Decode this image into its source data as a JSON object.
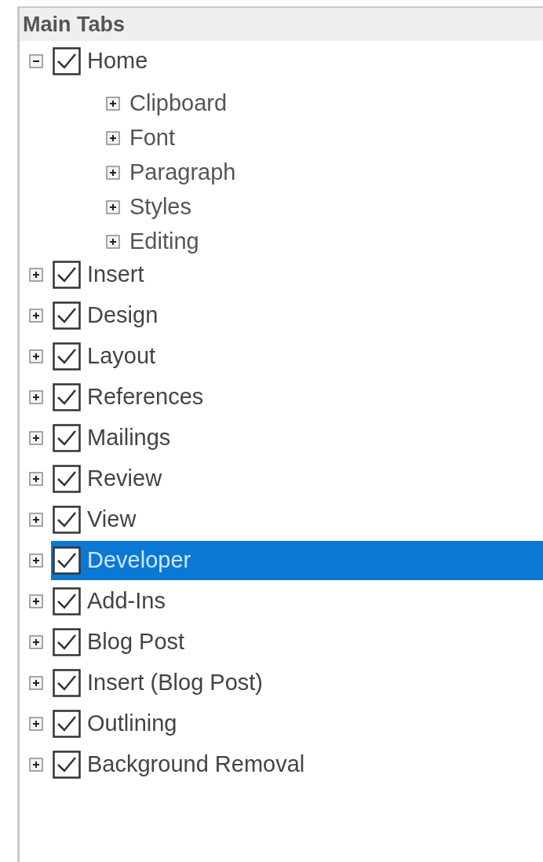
{
  "header": "Main Tabs",
  "tabs": [
    {
      "label": "Home",
      "checked": true,
      "expanded": true,
      "selected": false,
      "children": [
        {
          "label": "Clipboard",
          "expanded": false
        },
        {
          "label": "Font",
          "expanded": false
        },
        {
          "label": "Paragraph",
          "expanded": false
        },
        {
          "label": "Styles",
          "expanded": false
        },
        {
          "label": "Editing",
          "expanded": false
        }
      ]
    },
    {
      "label": "Insert",
      "checked": true,
      "expanded": false,
      "selected": false
    },
    {
      "label": "Design",
      "checked": true,
      "expanded": false,
      "selected": false
    },
    {
      "label": "Layout",
      "checked": true,
      "expanded": false,
      "selected": false
    },
    {
      "label": "References",
      "checked": true,
      "expanded": false,
      "selected": false
    },
    {
      "label": "Mailings",
      "checked": true,
      "expanded": false,
      "selected": false
    },
    {
      "label": "Review",
      "checked": true,
      "expanded": false,
      "selected": false
    },
    {
      "label": "View",
      "checked": true,
      "expanded": false,
      "selected": false
    },
    {
      "label": "Developer",
      "checked": true,
      "expanded": false,
      "selected": true
    },
    {
      "label": "Add-Ins",
      "checked": true,
      "expanded": false,
      "selected": false
    },
    {
      "label": "Blog Post",
      "checked": true,
      "expanded": false,
      "selected": false
    },
    {
      "label": "Insert (Blog Post)",
      "checked": true,
      "expanded": false,
      "selected": false
    },
    {
      "label": "Outlining",
      "checked": true,
      "expanded": false,
      "selected": false
    },
    {
      "label": "Background Removal",
      "checked": true,
      "expanded": false,
      "selected": false
    }
  ]
}
